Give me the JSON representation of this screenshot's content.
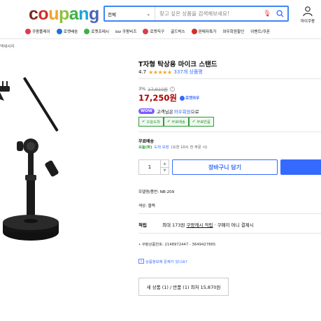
{
  "header": {
    "logo_letters": [
      {
        "ch": "c",
        "color": "#7a2e1f"
      },
      {
        "ch": "o",
        "color": "#d0322b"
      },
      {
        "ch": "u",
        "color": "#f0a32b"
      },
      {
        "ch": "p",
        "color": "#8fbf3e"
      },
      {
        "ch": "a",
        "color": "#3fb049"
      },
      {
        "ch": "n",
        "color": "#1fa3dc"
      },
      {
        "ch": "g",
        "color": "#4a67b2"
      }
    ],
    "search": {
      "category": "전체",
      "placeholder": "찾고 싶은 상품을 검색해보세요!"
    },
    "mypage_label": "마이쿠팡"
  },
  "nav": [
    {
      "label": "쿠팡플레이",
      "icon": "play-icon",
      "color": "#e03c4a"
    },
    {
      "label": "로켓배송",
      "icon": "rocket-icon",
      "color": "#1f6fe0"
    },
    {
      "label": "로켓프레시",
      "icon": "rocket-fresh-icon",
      "color": "#3fb049"
    },
    {
      "label": "biz 쿠팡비즈",
      "icon": "",
      "color": ""
    },
    {
      "label": "로켓직구",
      "icon": "rocket-global-icon",
      "color": "#e03c4a"
    },
    {
      "label": "골드박스",
      "icon": "",
      "color": ""
    },
    {
      "label": "판매자특가",
      "icon": "seller-icon",
      "color": "#d0322b"
    },
    {
      "label": "와우회원할인",
      "icon": "",
      "color": ""
    },
    {
      "label": "이벤트/쿠폰",
      "icon": "",
      "color": ""
    }
  ],
  "breadcrumb": "액세서리",
  "product": {
    "title": "T자형 탁상용 마이크 스탠드",
    "rating": "4.7",
    "stars": "★★★★★",
    "review_count": "337개 상품평",
    "discount_rate": "3%",
    "original_price": "17,910원",
    "price": "17,250원",
    "rocket_label": "로켓와우",
    "wow_badge": "WOW",
    "wow_text": "고객님은",
    "wow_link": "와우회원",
    "wow_suffix": "으로",
    "tags": [
      "오늘도착",
      "무료배송",
      "무료반품"
    ],
    "shipping_title": "무료배송",
    "shipping_date": "오늘(화)",
    "shipping_guarantee": "도착 보장",
    "shipping_note": "(오전 10시 전 주문 시)",
    "quantity": "1",
    "cart_label": "장바구니 담기",
    "model": "모델명/품번: NB-209",
    "color": "색상: 블랙",
    "save_label": "적립",
    "save_text": "최대 173원",
    "save_link": "쿠팡캐시 적립",
    "save_suffix": "· 쿠페이 머니 결제시",
    "product_code": "쿠팡상품번호: 2148972447 - 3649427865",
    "report_label": "상품정보에 문제가 있나요?",
    "others_label": "새 상품 (1) / 반품 (1) 최저 15,870원"
  }
}
